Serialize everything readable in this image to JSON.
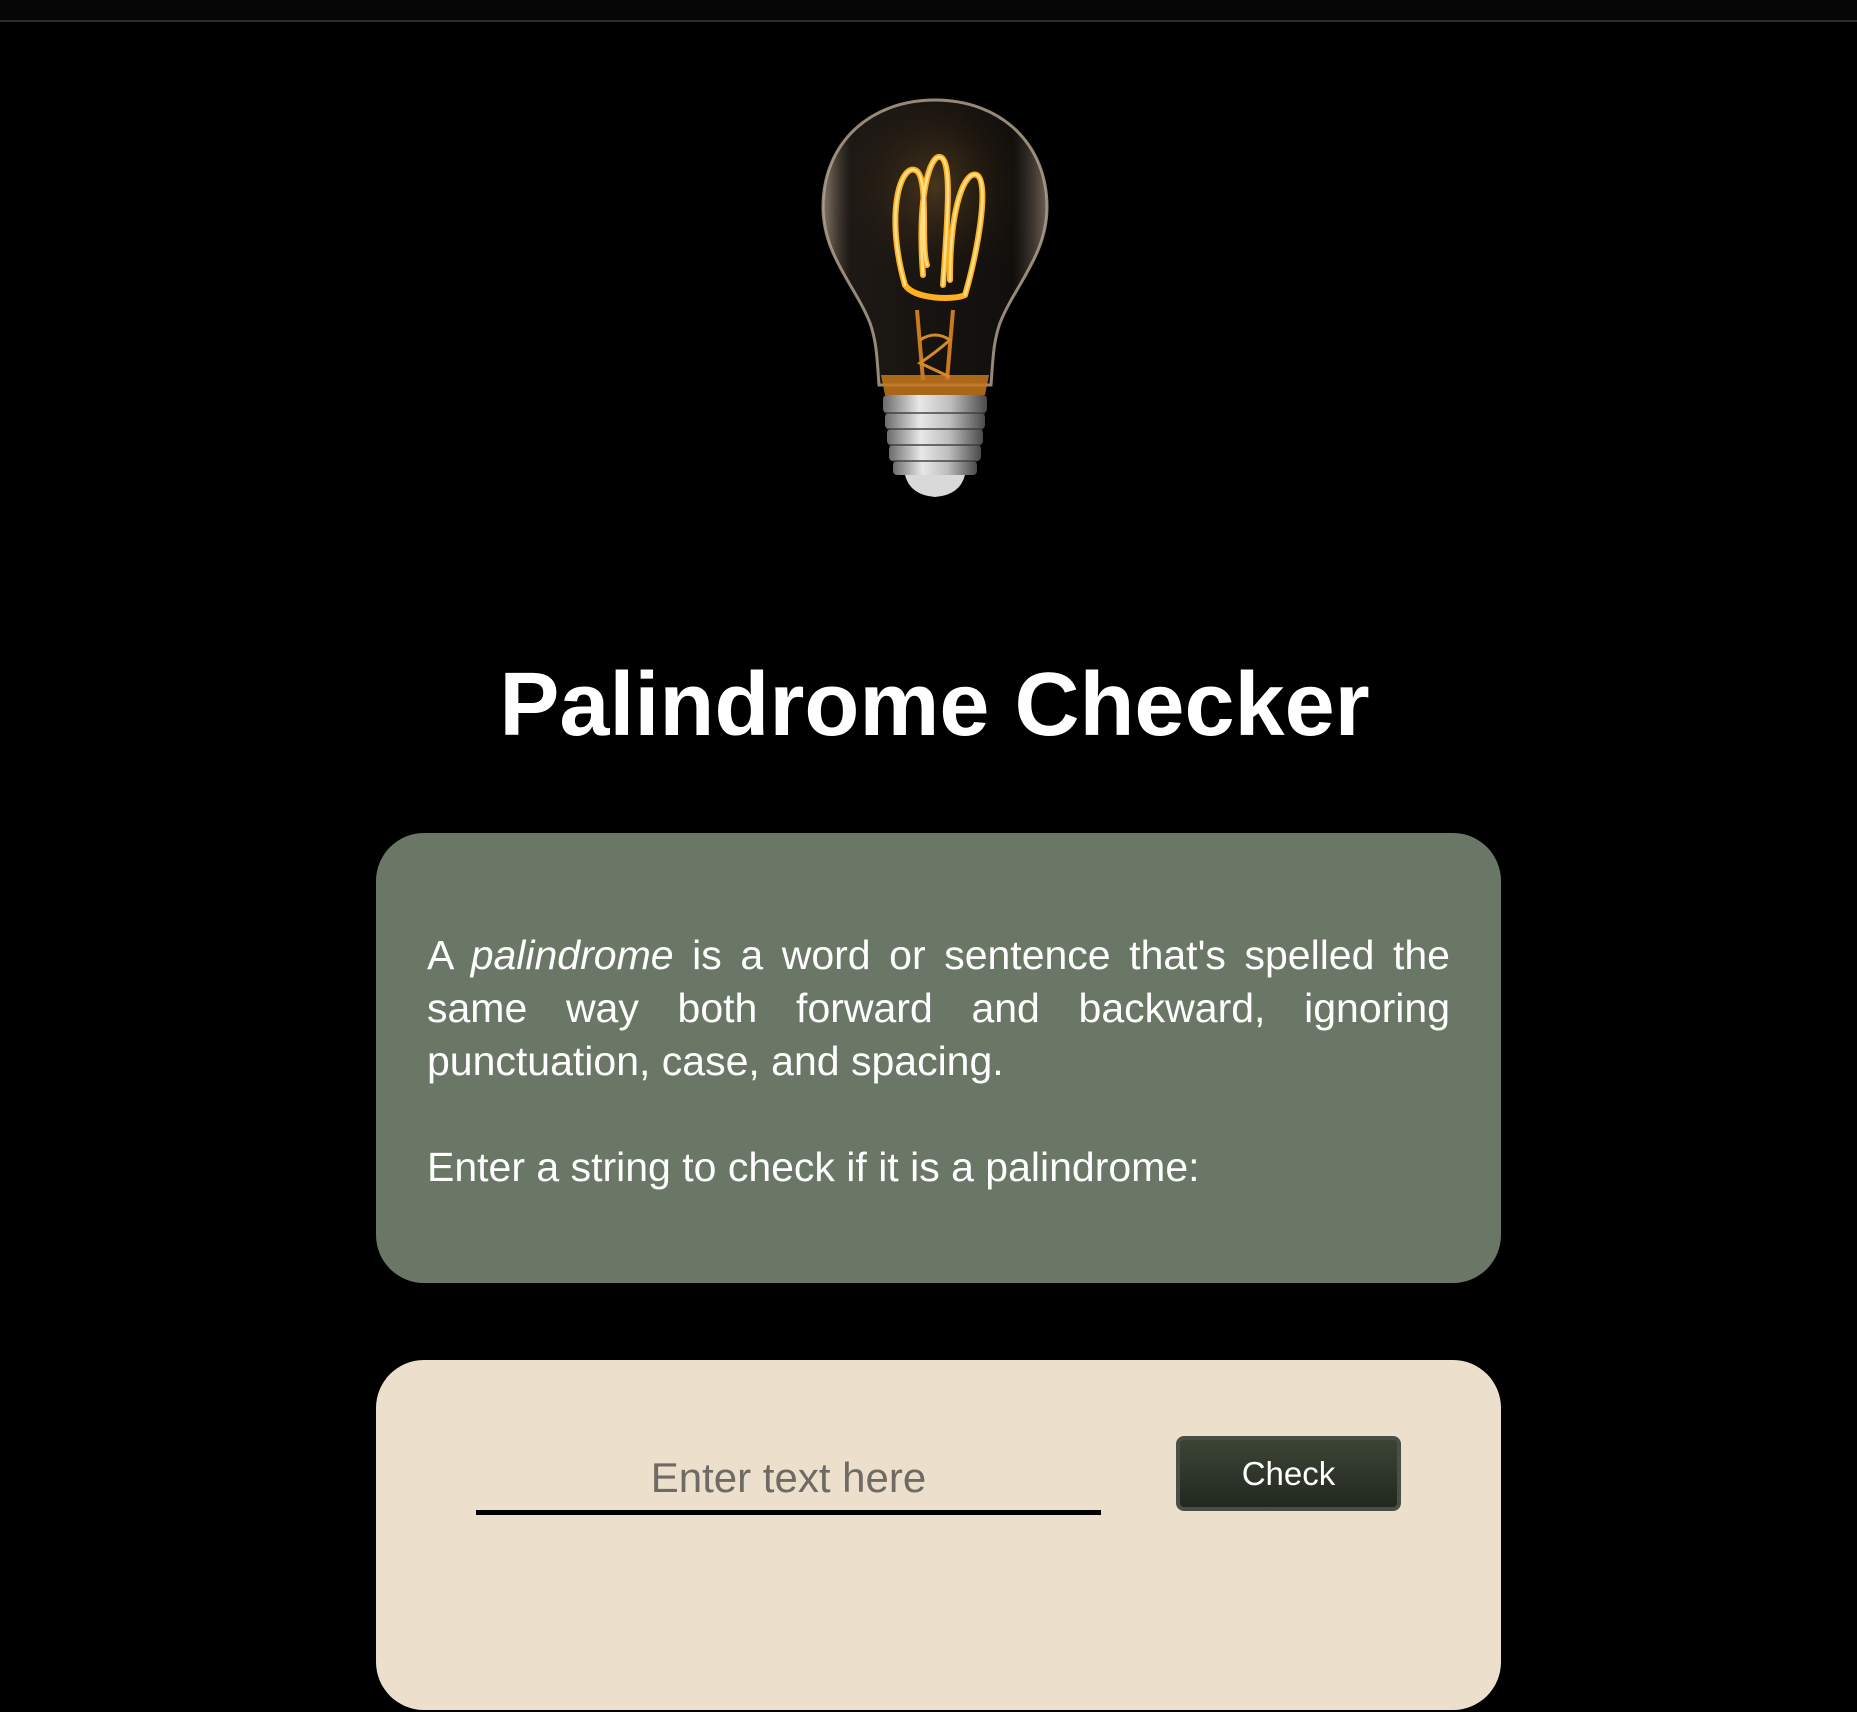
{
  "page": {
    "title": "Palindrome Checker"
  },
  "hero": {
    "image_name": "lightbulb-icon"
  },
  "info": {
    "intro_article": "A",
    "intro_term": "palindrome",
    "intro_rest": "is a word or sentence that's spelled the same way both forward and backward, ignoring punctuation, case, and spacing.",
    "prompt": "Enter a string to check if it is a palindrome:"
  },
  "form": {
    "input_value": "",
    "input_placeholder": "Enter text here",
    "check_label": "Check"
  },
  "colors": {
    "background": "#000000",
    "info_card": "#6a7666",
    "input_card": "#ece0cc",
    "button": "#2f362b",
    "bulb_glow": "#f5a623"
  }
}
